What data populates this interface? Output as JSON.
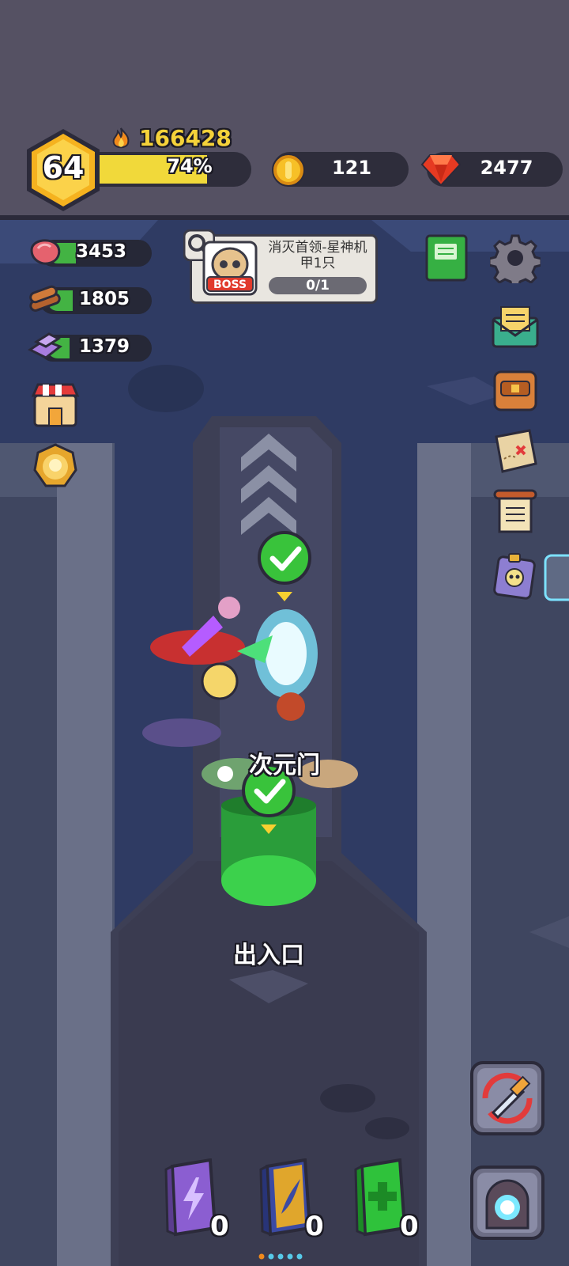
{
  "header": {
    "level": "64",
    "power": "166428",
    "xp_percent_label": "74%",
    "xp_fraction": 0.74,
    "coins": "121",
    "gems": "2477"
  },
  "resources": [
    {
      "name": "meat-icon",
      "value": "3453",
      "fill": 0.25
    },
    {
      "name": "wood-icon",
      "value": "1805",
      "fill": 0.2
    },
    {
      "name": "crystal-icon",
      "value": "1379",
      "fill": 0.15
    }
  ],
  "quest": {
    "badge": "BOSS",
    "title": "消灭首领-星神机甲1只",
    "progress": "0/1"
  },
  "map": {
    "portal_label": "次元门",
    "exit_label": "出入口"
  },
  "books": [
    {
      "name": "lightning-book",
      "count": "0",
      "color": "#8b5ed1"
    },
    {
      "name": "wing-book",
      "count": "0",
      "color": "#e0a62c"
    },
    {
      "name": "heal-book",
      "count": "0",
      "color": "#2fc23b"
    }
  ],
  "colors": {
    "xp_fill": "#f1d93a",
    "resource_fill": "#43b343",
    "map_bg": "#2f3b63",
    "top_bg": "#555163"
  }
}
